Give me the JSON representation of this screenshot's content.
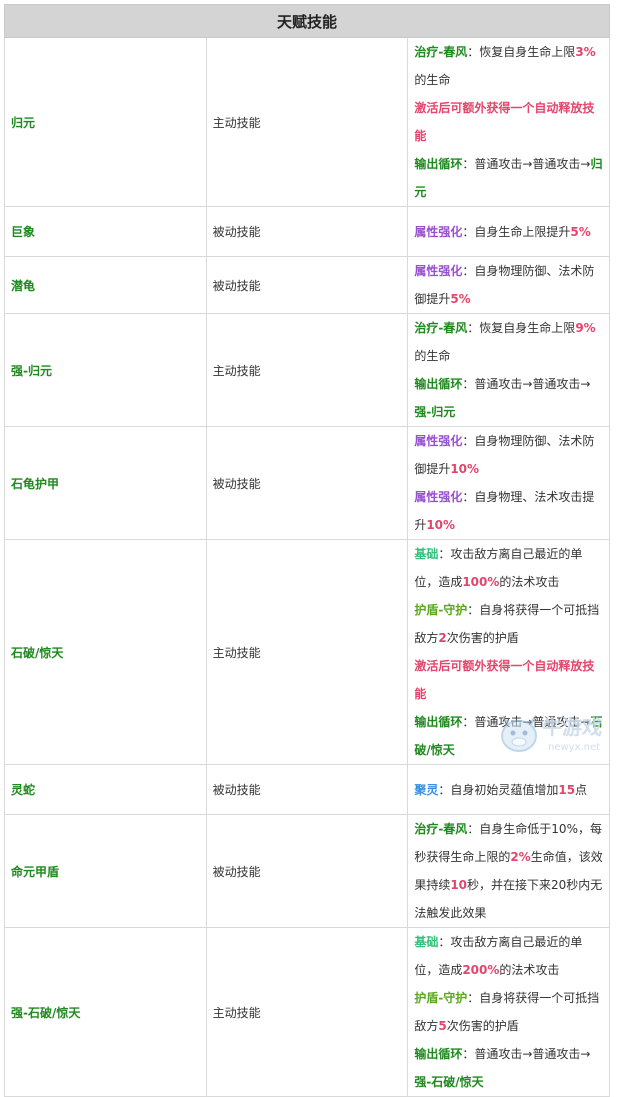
{
  "colors": {
    "name": "#1e8a1e",
    "heal": "#1e8a1e",
    "attr": "#9a4fd1",
    "red": "#e3456b",
    "num": "#e3456b",
    "base": "#33c07a",
    "shield": "#5aa81e",
    "cycle": "#1e8a1e",
    "spirit": "#3a8ee0"
  },
  "table": {
    "title": "天赋技能",
    "rows": [
      {
        "name": "归元",
        "type": "主动技能",
        "lines": [
          [
            {
              "t": "治疗-春风",
              "c": "heal",
              "b": true
            },
            {
              "t": "：恢复自身生命上限"
            },
            {
              "t": "3%",
              "c": "num",
              "b": true
            },
            {
              "t": "的生命"
            }
          ],
          [
            {
              "t": "激活后可额外获得一个自动释放技能",
              "c": "red",
              "b": true
            }
          ],
          [
            {
              "t": "输出循环",
              "c": "cycle",
              "b": true
            },
            {
              "t": "：普通攻击→普通攻击→"
            },
            {
              "t": "归元",
              "c": "cycle",
              "b": true
            }
          ]
        ]
      },
      {
        "name": "巨象",
        "type": "被动技能",
        "lines": [
          [
            {
              "t": "属性强化",
              "c": "attr",
              "b": true
            },
            {
              "t": "：自身生命上限提升"
            },
            {
              "t": "5%",
              "c": "num",
              "b": true
            }
          ]
        ]
      },
      {
        "name": "潜龟",
        "type": "被动技能",
        "lines": [
          [
            {
              "t": "属性强化",
              "c": "attr",
              "b": true
            },
            {
              "t": "：自身物理防御、法术防御提升"
            },
            {
              "t": "5%",
              "c": "num",
              "b": true
            }
          ]
        ]
      },
      {
        "name": "强-归元",
        "type": "主动技能",
        "lines": [
          [
            {
              "t": "治疗-春风",
              "c": "heal",
              "b": true
            },
            {
              "t": "：恢复自身生命上限"
            },
            {
              "t": "9%",
              "c": "num",
              "b": true
            },
            {
              "t": "的生命"
            }
          ],
          [
            {
              "t": "输出循环",
              "c": "cycle",
              "b": true
            },
            {
              "t": "：普通攻击→普通攻击→"
            },
            {
              "t": "强-归元",
              "c": "cycle",
              "b": true
            }
          ]
        ]
      },
      {
        "name": "石龟护甲",
        "type": "被动技能",
        "lines": [
          [
            {
              "t": "属性强化",
              "c": "attr",
              "b": true
            },
            {
              "t": "：自身物理防御、法术防御提升"
            },
            {
              "t": "10%",
              "c": "num",
              "b": true
            }
          ],
          [
            {
              "t": "属性强化",
              "c": "attr",
              "b": true
            },
            {
              "t": "：自身物理、法术攻击提升"
            },
            {
              "t": "10%",
              "c": "num",
              "b": true
            }
          ]
        ]
      },
      {
        "name": "石破/惊天",
        "type": "主动技能",
        "lines": [
          [
            {
              "t": "基础",
              "c": "base",
              "b": true
            },
            {
              "t": "：攻击敌方离自己最近的单位，造成"
            },
            {
              "t": "100%",
              "c": "num",
              "b": true
            },
            {
              "t": "的法术攻击"
            }
          ],
          [
            {
              "t": "护盾-守护",
              "c": "shield",
              "b": true
            },
            {
              "t": "：自身将获得一个可抵挡敌方"
            },
            {
              "t": "2",
              "c": "num",
              "b": true
            },
            {
              "t": "次伤害的护盾"
            }
          ],
          [
            {
              "t": "激活后可额外获得一个自动释放技能",
              "c": "red",
              "b": true
            }
          ],
          [
            {
              "t": "输出循环",
              "c": "cycle",
              "b": true
            },
            {
              "t": "：普通攻击→普通攻击→"
            },
            {
              "t": "石破/惊天",
              "c": "cycle",
              "b": true
            }
          ]
        ]
      },
      {
        "name": "灵蛇",
        "type": "被动技能",
        "lines": [
          [
            {
              "t": "聚灵",
              "c": "spirit",
              "b": true
            },
            {
              "t": "：自身初始灵蕴值增加"
            },
            {
              "t": "15",
              "c": "num",
              "b": true
            },
            {
              "t": "点"
            }
          ]
        ]
      },
      {
        "name": "命元甲盾",
        "type": "被动技能",
        "lines": [
          [
            {
              "t": "治疗-春风",
              "c": "heal",
              "b": true
            },
            {
              "t": "：自身生命低于10%，每秒获得生命上限的"
            },
            {
              "t": "2%",
              "c": "num",
              "b": true
            },
            {
              "t": "生命值，该效"
            }
          ],
          [
            {
              "t": "果持续"
            },
            {
              "t": "10",
              "c": "num",
              "b": true
            },
            {
              "t": "秒，并在接下来20秒内无法触发此效果"
            }
          ]
        ]
      },
      {
        "name": "强-石破/惊天",
        "type": "主动技能",
        "lines": [
          [
            {
              "t": "基础",
              "c": "base",
              "b": true
            },
            {
              "t": "：攻击敌方离自己最近的单位，造成"
            },
            {
              "t": "200%",
              "c": "num",
              "b": true
            },
            {
              "t": "的法术攻击"
            }
          ],
          [
            {
              "t": "护盾-守护",
              "c": "shield",
              "b": true
            },
            {
              "t": "：自身将获得一个可抵挡敌方"
            },
            {
              "t": "5",
              "c": "num",
              "b": true
            },
            {
              "t": "次伤害的护盾"
            }
          ],
          [
            {
              "t": "输出循环",
              "c": "cycle",
              "b": true
            },
            {
              "t": "：普通攻击→普通攻击→"
            },
            {
              "t": "强-石破/惊天",
              "c": "cycle",
              "b": true
            }
          ]
        ]
      }
    ]
  },
  "watermark": {
    "text": "牛游戏",
    "url_text": "newyx.net",
    "icon": "cow-mascot-icon"
  }
}
